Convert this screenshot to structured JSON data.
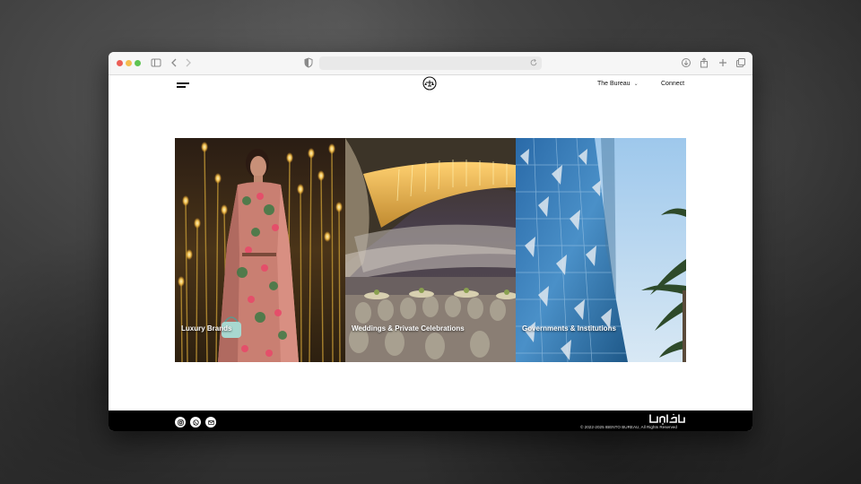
{
  "browser": {
    "window_controls": [
      "close",
      "minimize",
      "zoom"
    ],
    "toolbar_icons": [
      "sidebar-icon",
      "back-icon",
      "forward-icon",
      "shield-icon",
      "reload-icon",
      "download-icon",
      "share-icon",
      "new-tab-icon",
      "tabs-overview-icon"
    ],
    "url": ""
  },
  "header": {
    "menu_icon": "hamburger-icon",
    "logo_icon": "scales-logo-icon",
    "nav": {
      "bureau_label": "The Bureau",
      "bureau_chevron": "⌄",
      "connect_label": "Connect"
    }
  },
  "gallery": {
    "panels": [
      {
        "caption": "Luxury Brands"
      },
      {
        "caption": "Weddings & Private Celebrations"
      },
      {
        "caption": "Governments & Institutions"
      }
    ]
  },
  "footer": {
    "social_icons": [
      "instagram-icon",
      "whatsapp-icon",
      "email-icon"
    ],
    "brand_logo": "arabic-wordmark-logo",
    "copyright": "© 2022-2025 IBENTO BUREAU, All Rights Reserved"
  },
  "colors": {
    "background": "#3a3a3a",
    "window": "#ffffff",
    "footer": "#000000",
    "text": "#111111"
  }
}
